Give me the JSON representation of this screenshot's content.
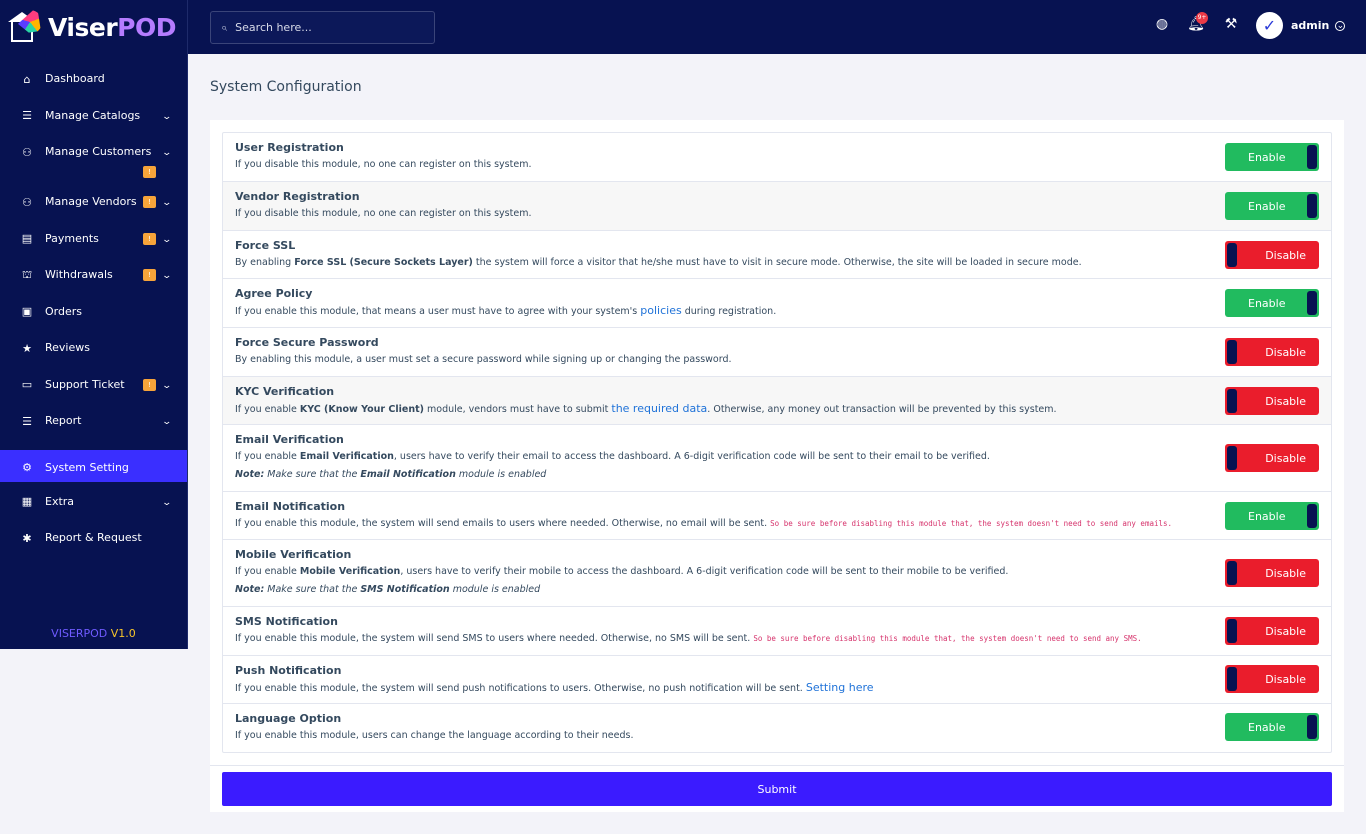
{
  "brand": {
    "part1": "Viser",
    "part2": "POD"
  },
  "sidebar": {
    "items": [
      {
        "label": "Dashboard",
        "icon": "home-icon"
      },
      {
        "label": "Manage Catalogs",
        "icon": "list-icon"
      },
      {
        "label": "Manage Customers",
        "icon": "users-icon",
        "badge": "!"
      },
      {
        "label": "Manage Vendors",
        "icon": "users-icon",
        "badge": "!"
      },
      {
        "label": "Payments",
        "icon": "receipt-icon",
        "badge": "!"
      },
      {
        "label": "Withdrawals",
        "icon": "bank-icon",
        "badge": "!"
      },
      {
        "label": "Orders",
        "icon": "money-icon"
      },
      {
        "label": "Reviews",
        "icon": "star-icon"
      },
      {
        "label": "Support Ticket",
        "icon": "ticket-icon",
        "badge": "!"
      },
      {
        "label": "Report",
        "icon": "list-icon"
      },
      {
        "label": "System Setting",
        "icon": "gear-icon"
      },
      {
        "label": "Extra",
        "icon": "server-icon"
      },
      {
        "label": "Report & Request",
        "icon": "bug-icon"
      }
    ],
    "footer": {
      "name": "VISERPOD",
      "version": "V1.0"
    }
  },
  "topbar": {
    "search_placeholder": "Search here...",
    "notif_count": "9+",
    "username": "admin"
  },
  "page": {
    "title": "System Configuration"
  },
  "settings": [
    {
      "title": "User Registration",
      "desc": "If you disable this module, no one can register on this system.",
      "state": "Enable"
    },
    {
      "title": "Vendor Registration",
      "desc": "If you disable this module, no one can register on this system.",
      "state": "Enable"
    },
    {
      "title": "Force SSL",
      "desc_pre": "By enabling ",
      "desc_bold": "Force SSL (Secure Sockets Layer)",
      "desc_post": " the system will force a visitor that he/she must have to visit in secure mode. Otherwise, the site will be loaded in secure mode.",
      "state": "Disable"
    },
    {
      "title": "Agree Policy",
      "desc_pre": "If you enable this module, that means a user must have to agree with your system's ",
      "desc_link": "policies",
      "desc_post": " during registration.",
      "state": "Enable"
    },
    {
      "title": "Force Secure Password",
      "desc": "By enabling this module, a user must set a secure password while signing up or changing the password.",
      "state": "Disable"
    },
    {
      "title": "KYC Verification",
      "desc_pre": "If you enable ",
      "desc_bold": "KYC (Know Your Client)",
      "desc_mid": " module, vendors must have to submit ",
      "desc_link": "the required data",
      "desc_post": ". Otherwise, any money out transaction will be prevented by this system.",
      "state": "Disable"
    },
    {
      "title": "Email Verification",
      "desc_pre": "If you enable ",
      "desc_bold": "Email Verification",
      "desc_post": ", users have to verify their email to access the dashboard. A 6-digit verification code will be sent to their email to be verified.",
      "note_label": "Note:",
      "note_pre": " Make sure that the ",
      "note_bold": "Email Notification",
      "note_post": " module is enabled",
      "state": "Disable"
    },
    {
      "title": "Email Notification",
      "desc": "If you enable this module, the system will send emails to users where needed. Otherwise, no email will be sent.",
      "code": "So be sure before disabling this module that, the system doesn't need to send any emails.",
      "state": "Enable"
    },
    {
      "title": "Mobile Verification",
      "desc_pre": "If you enable ",
      "desc_bold": "Mobile Verification",
      "desc_post": ", users have to verify their mobile to access the dashboard. A 6-digit verification code will be sent to their mobile to be verified.",
      "note_label": "Note:",
      "note_pre": " Make sure that the ",
      "note_bold": "SMS Notification",
      "note_post": " module is enabled",
      "state": "Disable"
    },
    {
      "title": "SMS Notification",
      "desc": "If you enable this module, the system will send SMS to users where needed. Otherwise, no SMS will be sent.",
      "code": "So be sure before disabling this module that, the system doesn't need to send any SMS.",
      "state": "Disable"
    },
    {
      "title": "Push Notification",
      "desc": "If you enable this module, the system will send push notifications to users. Otherwise, no push notification will be sent.",
      "link": "Setting here",
      "state": "Disable"
    },
    {
      "title": "Language Option",
      "desc": "If you enable this module, users can change the language according to their needs.",
      "state": "Enable"
    }
  ],
  "submit_label": "Submit",
  "colors": {
    "sidebar_bg": "#071251",
    "accent": "#3b1bff",
    "enable": "#21bb5f",
    "disable": "#ea1d2c",
    "badge": "#f7a43a"
  }
}
